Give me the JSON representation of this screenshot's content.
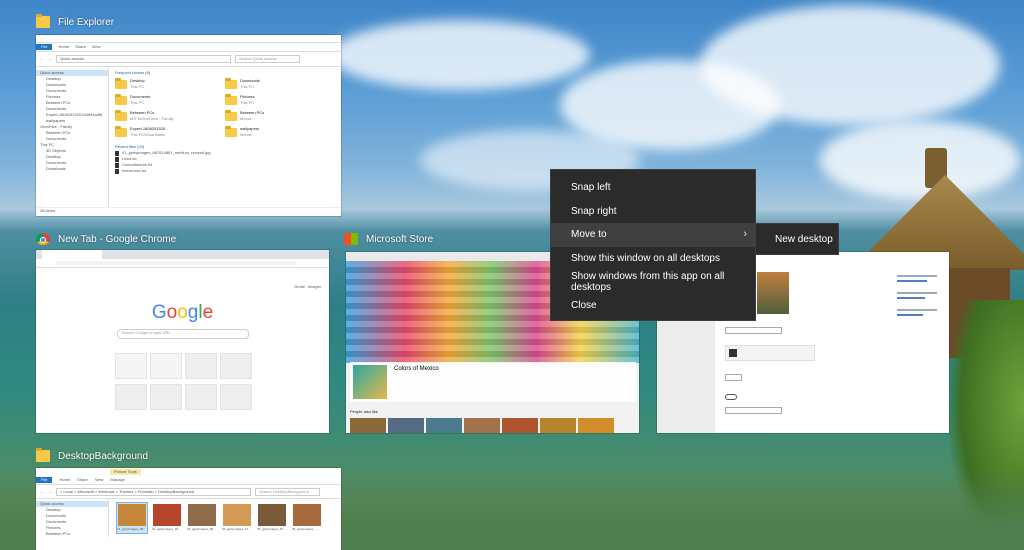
{
  "windows": {
    "file_explorer": {
      "title": "File Explorer",
      "tabs": [
        "File",
        "Home",
        "Share",
        "View"
      ],
      "address": "Quick access",
      "search_placeholder": "Search Quick access",
      "nav": [
        "Quick access",
        "Desktop",
        "Downloads",
        "Documents",
        "Pictures",
        "Between PCs",
        "Documents",
        "Expert-1806251520184694a4f8",
        "wallpapers",
        "OneDrive - Family",
        "Between PCs",
        "Documents",
        "This PC",
        "3D Objects",
        "Desktop",
        "Documents",
        "Downloads"
      ],
      "frequent_header": "Frequent folders (8)",
      "folders": [
        {
          "name": "Desktop",
          "path": "This PC"
        },
        {
          "name": "Downloads",
          "path": "This PC"
        },
        {
          "name": "Documents",
          "path": "This PC"
        },
        {
          "name": "Pictures",
          "path": "This PC"
        },
        {
          "name": "Between PCs",
          "path": "MS ToOneDrive - Family"
        },
        {
          "name": "Between PCs",
          "path": "Mount..."
        },
        {
          "name": "Expert-1806251520...",
          "path": "This PC\\Downloads"
        },
        {
          "name": "wallpapers",
          "path": "Mount..."
        }
      ],
      "recent_header": "Recent files (20)",
      "recent": [
        "01_gettyimages_687614801_medium_resized.jpg",
        "Links.txt",
        "Commitments.txt",
        "Inferences.txt"
      ],
      "status": "28 items"
    },
    "chrome": {
      "title": "New Tab - Google Chrome",
      "logo": "Google",
      "search_placeholder": "Search Google or type URL",
      "links": [
        "Gmail",
        "Images"
      ]
    },
    "store": {
      "title": "Microsoft Store",
      "feature_title": "Colors of Mexico",
      "people_also_like": "People also like"
    },
    "desktop_bg": {
      "title": "DesktopBackground",
      "contextual_tab": "Picture Tools",
      "tabs": [
        "File",
        "Home",
        "Share",
        "View",
        "Manage"
      ],
      "breadcrumb": "« Local > Microsoft > Windows > Themes > Fountain > DesktopBackground",
      "search_placeholder": "Search DesktopBackground",
      "nav": [
        "Quick access",
        "Desktop",
        "Downloads",
        "Documents",
        "Pictures",
        "Between PCs"
      ],
      "files": [
        "01_gettyimages_687614801_medium_resized.jpg",
        "02_gettyimages_944294816_high_resized.jpg",
        "03_gettyimages_509754664_medium_resized.jpg",
        "04_gettyimages_174406786_super_resized.jpg",
        "05_gettyimages_517261598_super_resized.jpg",
        "06_gettyimages_..._super_resized.jpg"
      ]
    }
  },
  "context_menu": {
    "items": [
      "Snap left",
      "Snap right",
      "Move to",
      "Show this window on all desktops",
      "Show windows from this app on all desktops",
      "Close"
    ],
    "submenu": "New desktop"
  },
  "colors": {
    "menu_bg": "#2b2b2b",
    "menu_hover": "#404040",
    "accent": "#1e74c8"
  }
}
